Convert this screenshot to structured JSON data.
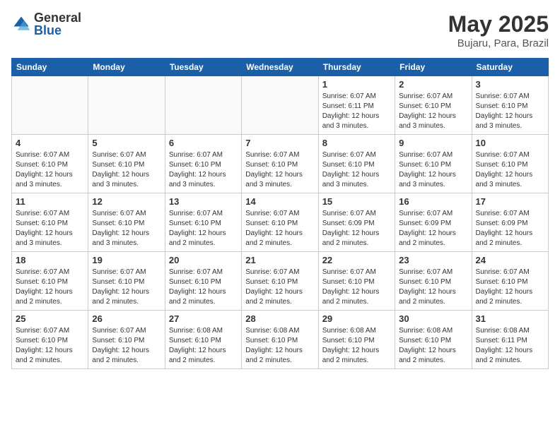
{
  "header": {
    "logo_general": "General",
    "logo_blue": "Blue",
    "month_title": "May 2025",
    "location": "Bujaru, Para, Brazil"
  },
  "weekdays": [
    "Sunday",
    "Monday",
    "Tuesday",
    "Wednesday",
    "Thursday",
    "Friday",
    "Saturday"
  ],
  "weeks": [
    [
      {
        "day": "",
        "info": ""
      },
      {
        "day": "",
        "info": ""
      },
      {
        "day": "",
        "info": ""
      },
      {
        "day": "",
        "info": ""
      },
      {
        "day": "1",
        "info": "Sunrise: 6:07 AM\nSunset: 6:11 PM\nDaylight: 12 hours\nand 3 minutes."
      },
      {
        "day": "2",
        "info": "Sunrise: 6:07 AM\nSunset: 6:10 PM\nDaylight: 12 hours\nand 3 minutes."
      },
      {
        "day": "3",
        "info": "Sunrise: 6:07 AM\nSunset: 6:10 PM\nDaylight: 12 hours\nand 3 minutes."
      }
    ],
    [
      {
        "day": "4",
        "info": "Sunrise: 6:07 AM\nSunset: 6:10 PM\nDaylight: 12 hours\nand 3 minutes."
      },
      {
        "day": "5",
        "info": "Sunrise: 6:07 AM\nSunset: 6:10 PM\nDaylight: 12 hours\nand 3 minutes."
      },
      {
        "day": "6",
        "info": "Sunrise: 6:07 AM\nSunset: 6:10 PM\nDaylight: 12 hours\nand 3 minutes."
      },
      {
        "day": "7",
        "info": "Sunrise: 6:07 AM\nSunset: 6:10 PM\nDaylight: 12 hours\nand 3 minutes."
      },
      {
        "day": "8",
        "info": "Sunrise: 6:07 AM\nSunset: 6:10 PM\nDaylight: 12 hours\nand 3 minutes."
      },
      {
        "day": "9",
        "info": "Sunrise: 6:07 AM\nSunset: 6:10 PM\nDaylight: 12 hours\nand 3 minutes."
      },
      {
        "day": "10",
        "info": "Sunrise: 6:07 AM\nSunset: 6:10 PM\nDaylight: 12 hours\nand 3 minutes."
      }
    ],
    [
      {
        "day": "11",
        "info": "Sunrise: 6:07 AM\nSunset: 6:10 PM\nDaylight: 12 hours\nand 3 minutes."
      },
      {
        "day": "12",
        "info": "Sunrise: 6:07 AM\nSunset: 6:10 PM\nDaylight: 12 hours\nand 3 minutes."
      },
      {
        "day": "13",
        "info": "Sunrise: 6:07 AM\nSunset: 6:10 PM\nDaylight: 12 hours\nand 2 minutes."
      },
      {
        "day": "14",
        "info": "Sunrise: 6:07 AM\nSunset: 6:10 PM\nDaylight: 12 hours\nand 2 minutes."
      },
      {
        "day": "15",
        "info": "Sunrise: 6:07 AM\nSunset: 6:09 PM\nDaylight: 12 hours\nand 2 minutes."
      },
      {
        "day": "16",
        "info": "Sunrise: 6:07 AM\nSunset: 6:09 PM\nDaylight: 12 hours\nand 2 minutes."
      },
      {
        "day": "17",
        "info": "Sunrise: 6:07 AM\nSunset: 6:09 PM\nDaylight: 12 hours\nand 2 minutes."
      }
    ],
    [
      {
        "day": "18",
        "info": "Sunrise: 6:07 AM\nSunset: 6:10 PM\nDaylight: 12 hours\nand 2 minutes."
      },
      {
        "day": "19",
        "info": "Sunrise: 6:07 AM\nSunset: 6:10 PM\nDaylight: 12 hours\nand 2 minutes."
      },
      {
        "day": "20",
        "info": "Sunrise: 6:07 AM\nSunset: 6:10 PM\nDaylight: 12 hours\nand 2 minutes."
      },
      {
        "day": "21",
        "info": "Sunrise: 6:07 AM\nSunset: 6:10 PM\nDaylight: 12 hours\nand 2 minutes."
      },
      {
        "day": "22",
        "info": "Sunrise: 6:07 AM\nSunset: 6:10 PM\nDaylight: 12 hours\nand 2 minutes."
      },
      {
        "day": "23",
        "info": "Sunrise: 6:07 AM\nSunset: 6:10 PM\nDaylight: 12 hours\nand 2 minutes."
      },
      {
        "day": "24",
        "info": "Sunrise: 6:07 AM\nSunset: 6:10 PM\nDaylight: 12 hours\nand 2 minutes."
      }
    ],
    [
      {
        "day": "25",
        "info": "Sunrise: 6:07 AM\nSunset: 6:10 PM\nDaylight: 12 hours\nand 2 minutes."
      },
      {
        "day": "26",
        "info": "Sunrise: 6:07 AM\nSunset: 6:10 PM\nDaylight: 12 hours\nand 2 minutes."
      },
      {
        "day": "27",
        "info": "Sunrise: 6:08 AM\nSunset: 6:10 PM\nDaylight: 12 hours\nand 2 minutes."
      },
      {
        "day": "28",
        "info": "Sunrise: 6:08 AM\nSunset: 6:10 PM\nDaylight: 12 hours\nand 2 minutes."
      },
      {
        "day": "29",
        "info": "Sunrise: 6:08 AM\nSunset: 6:10 PM\nDaylight: 12 hours\nand 2 minutes."
      },
      {
        "day": "30",
        "info": "Sunrise: 6:08 AM\nSunset: 6:10 PM\nDaylight: 12 hours\nand 2 minutes."
      },
      {
        "day": "31",
        "info": "Sunrise: 6:08 AM\nSunset: 6:11 PM\nDaylight: 12 hours\nand 2 minutes."
      }
    ]
  ]
}
